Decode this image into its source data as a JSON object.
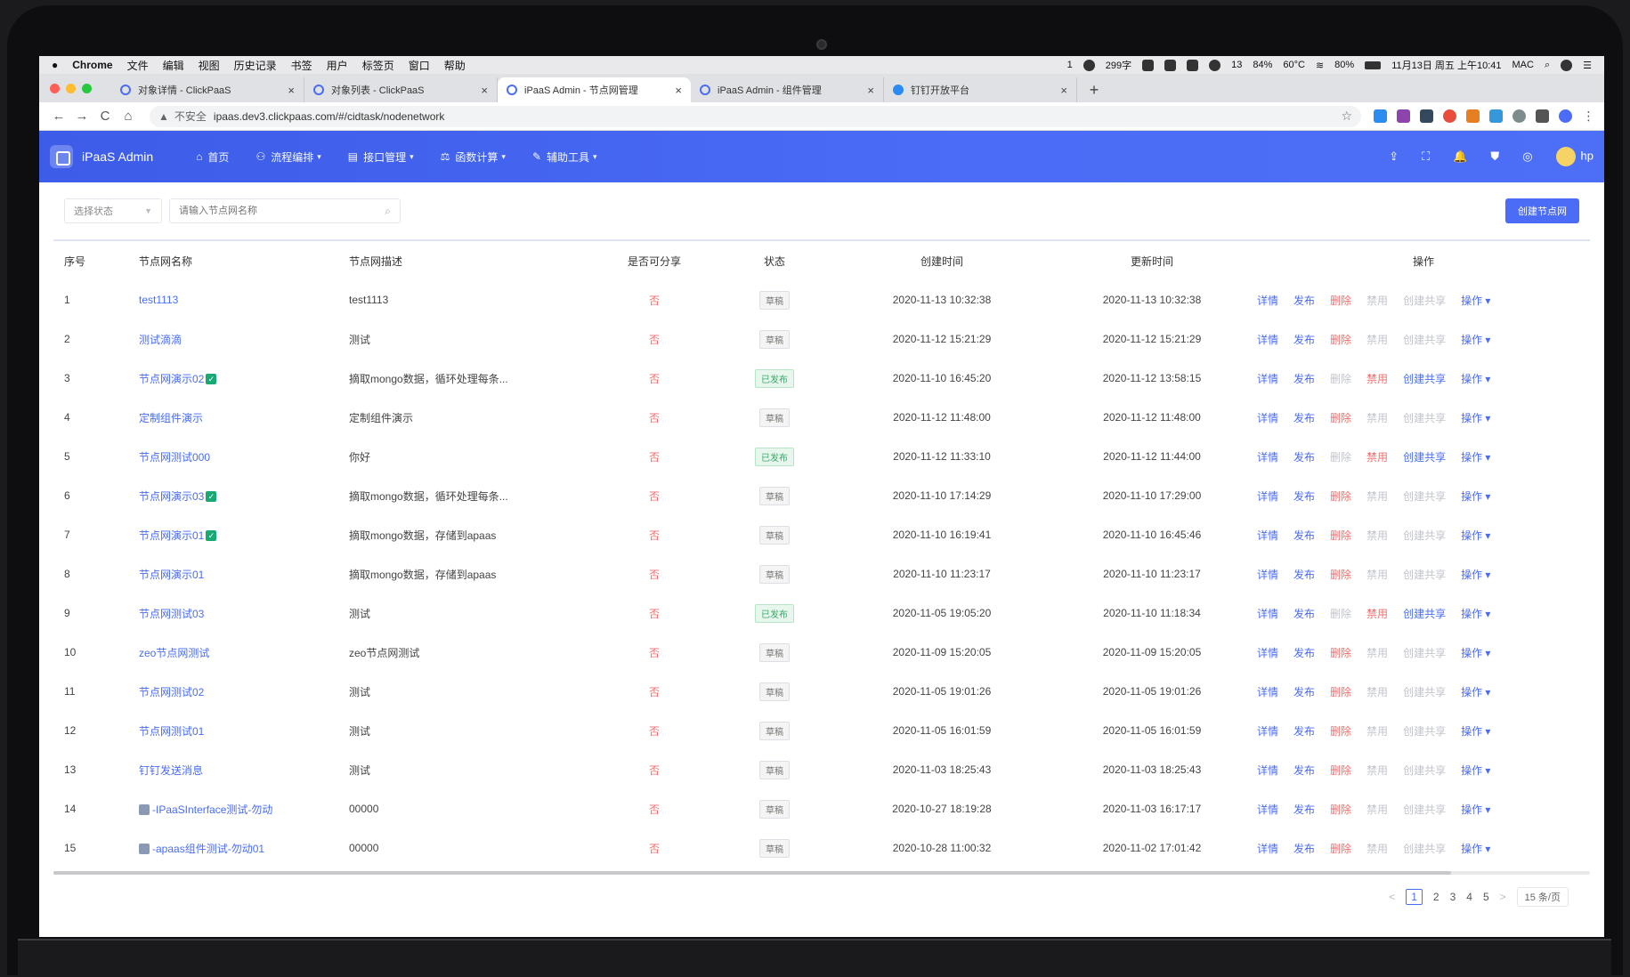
{
  "menubar": {
    "app": "Chrome",
    "items": [
      "文件",
      "编辑",
      "视图",
      "历史记录",
      "书签",
      "用户",
      "标签页",
      "窗口",
      "帮助"
    ],
    "status_left": "1",
    "status_net": "299字",
    "status_num": "13",
    "status_cpu": "84%",
    "status_temp": "60°C",
    "battery": "80%",
    "datetime": "11月13日 周五 上午10:41",
    "user": "MAC"
  },
  "tabs": [
    {
      "title": "对象详情 - ClickPaaS",
      "close": "×"
    },
    {
      "title": "对象列表 - ClickPaaS",
      "close": "×"
    },
    {
      "title": "iPaaS Admin - 节点网管理",
      "close": "×"
    },
    {
      "title": "iPaaS Admin - 组件管理",
      "close": "×"
    },
    {
      "title": "钉钉开放平台",
      "close": "×"
    }
  ],
  "newtab": "+",
  "address": {
    "back": "←",
    "forward": "→",
    "reload": "C",
    "home": "⌂",
    "insecure": "不安全",
    "url": "ipaas.dev3.clickpaas.com/#/cidtask/nodenetwork",
    "star": "☆"
  },
  "header": {
    "brand": "iPaaS Admin",
    "nav": [
      {
        "icon": "⌂",
        "label": "首页",
        "caret": ""
      },
      {
        "icon": "⚇",
        "label": "流程编排",
        "caret": "▾"
      },
      {
        "icon": "▤",
        "label": "接口管理",
        "caret": "▾"
      },
      {
        "icon": "⚖",
        "label": "函数计算",
        "caret": "▾"
      },
      {
        "icon": "✎",
        "label": "辅助工具",
        "caret": "▾"
      }
    ],
    "right_icons": [
      "⇪",
      "⛶",
      "🔔",
      "⛊",
      "◎"
    ],
    "user": "hp"
  },
  "toolbar": {
    "status_select": "选择状态",
    "search_placeholder": "请输入节点网名称",
    "create_button": "创建节点网"
  },
  "table": {
    "headers": {
      "idx": "序号",
      "name": "节点网名称",
      "desc": "节点网描述",
      "share": "是否可分享",
      "status": "状态",
      "created": "创建时间",
      "updated": "更新时间",
      "ops": "操作"
    },
    "op_labels": {
      "detail": "详情",
      "publish": "发布",
      "delete": "删除",
      "disable": "禁用",
      "share": "创建共享",
      "more": "操作 ▾"
    },
    "rows": [
      {
        "idx": "1",
        "name": "test1113",
        "check": false,
        "icon": false,
        "desc": "test1113",
        "share": "否",
        "status": "草稿",
        "published": false,
        "created": "2020-11-13 10:32:38",
        "updated": "2020-11-13 10:32:38"
      },
      {
        "idx": "2",
        "name": "测试滴滴",
        "check": false,
        "icon": false,
        "desc": "测试",
        "share": "否",
        "status": "草稿",
        "published": false,
        "created": "2020-11-12 15:21:29",
        "updated": "2020-11-12 15:21:29"
      },
      {
        "idx": "3",
        "name": "节点网演示02",
        "check": true,
        "icon": false,
        "desc": "摘取mongo数据，循环处理每条...",
        "share": "否",
        "status": "已发布",
        "published": true,
        "created": "2020-11-10 16:45:20",
        "updated": "2020-11-12 13:58:15"
      },
      {
        "idx": "4",
        "name": "定制组件演示",
        "check": false,
        "icon": false,
        "desc": "定制组件演示",
        "share": "否",
        "status": "草稿",
        "published": false,
        "created": "2020-11-12 11:48:00",
        "updated": "2020-11-12 11:48:00"
      },
      {
        "idx": "5",
        "name": "节点网测试000",
        "check": false,
        "icon": false,
        "desc": "你好",
        "share": "否",
        "status": "已发布",
        "published": true,
        "created": "2020-11-12 11:33:10",
        "updated": "2020-11-12 11:44:00"
      },
      {
        "idx": "6",
        "name": "节点网演示03",
        "check": true,
        "icon": false,
        "desc": "摘取mongo数据，循环处理每条...",
        "share": "否",
        "status": "草稿",
        "published": false,
        "created": "2020-11-10 17:14:29",
        "updated": "2020-11-10 17:29:00"
      },
      {
        "idx": "7",
        "name": "节点网演示01",
        "check": true,
        "icon": false,
        "desc": "摘取mongo数据，存储到apaas",
        "share": "否",
        "status": "草稿",
        "published": false,
        "created": "2020-11-10 16:19:41",
        "updated": "2020-11-10 16:45:46"
      },
      {
        "idx": "8",
        "name": "节点网演示01",
        "check": false,
        "icon": false,
        "desc": "摘取mongo数据，存储到apaas",
        "share": "否",
        "status": "草稿",
        "published": false,
        "created": "2020-11-10 11:23:17",
        "updated": "2020-11-10 11:23:17"
      },
      {
        "idx": "9",
        "name": "节点网测试03",
        "check": false,
        "icon": false,
        "desc": "测试",
        "share": "否",
        "status": "已发布",
        "published": true,
        "created": "2020-11-05 19:05:20",
        "updated": "2020-11-10 11:18:34"
      },
      {
        "idx": "10",
        "name": "zeo节点网测试",
        "check": false,
        "icon": false,
        "desc": "zeo节点网测试",
        "share": "否",
        "status": "草稿",
        "published": false,
        "created": "2020-11-09 15:20:05",
        "updated": "2020-11-09 15:20:05"
      },
      {
        "idx": "11",
        "name": "节点网测试02",
        "check": false,
        "icon": false,
        "desc": "测试",
        "share": "否",
        "status": "草稿",
        "published": false,
        "created": "2020-11-05 19:01:26",
        "updated": "2020-11-05 19:01:26"
      },
      {
        "idx": "12",
        "name": "节点网测试01",
        "check": false,
        "icon": false,
        "desc": "测试",
        "share": "否",
        "status": "草稿",
        "published": false,
        "created": "2020-11-05 16:01:59",
        "updated": "2020-11-05 16:01:59"
      },
      {
        "idx": "13",
        "name": "钉钉发送消息",
        "check": false,
        "icon": false,
        "desc": "测试",
        "share": "否",
        "status": "草稿",
        "published": false,
        "created": "2020-11-03 18:25:43",
        "updated": "2020-11-03 18:25:43"
      },
      {
        "idx": "14",
        "name": "-IPaaSInterface测试-勿动",
        "check": false,
        "icon": true,
        "desc": "00000",
        "share": "否",
        "status": "草稿",
        "published": false,
        "created": "2020-10-27 18:19:28",
        "updated": "2020-11-03 16:17:17"
      },
      {
        "idx": "15",
        "name": "-apaas组件测试-勿动01",
        "check": false,
        "icon": true,
        "desc": "00000",
        "share": "否",
        "status": "草稿",
        "published": false,
        "created": "2020-10-28 11:00:32",
        "updated": "2020-11-02 17:01:42"
      }
    ]
  },
  "pagination": {
    "prev": "<",
    "next": ">",
    "pages": [
      "1",
      "2",
      "3",
      "4",
      "5"
    ],
    "current": "1",
    "page_size": "15 条/页"
  },
  "colors": {
    "accent": "#4a6cf6",
    "danger": "#f56c6c",
    "success": "#3aa96a",
    "muted": "#c0c4cc"
  }
}
